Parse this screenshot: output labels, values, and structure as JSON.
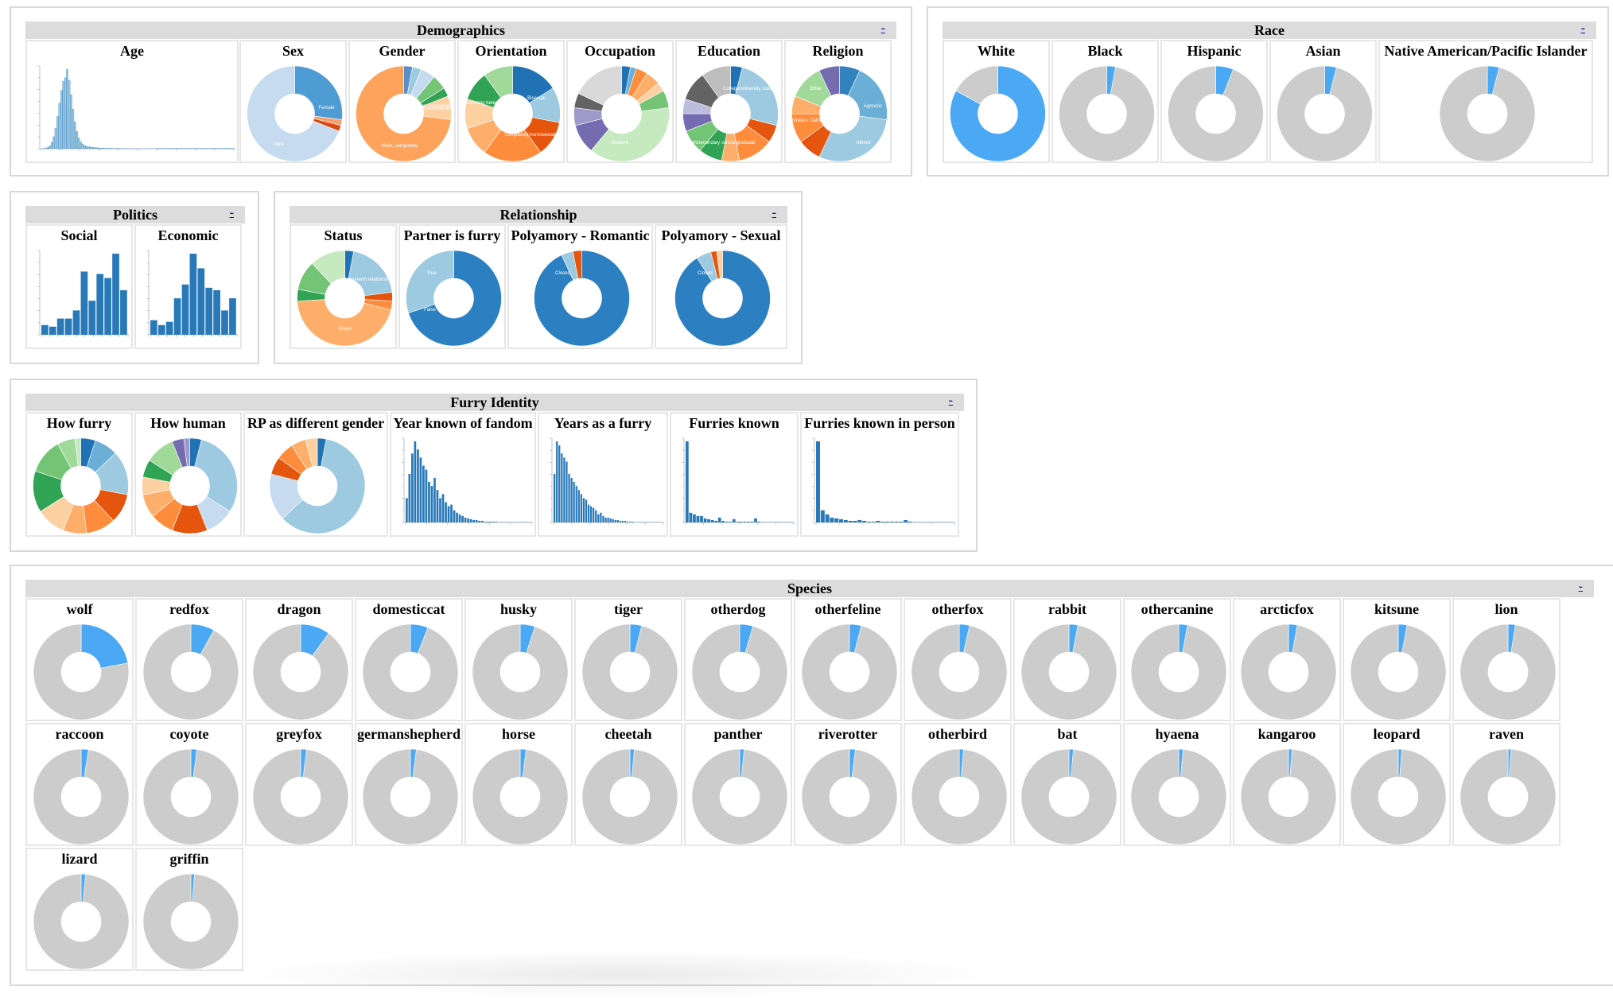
{
  "collapse_symbol": "-",
  "colors": {
    "blue_dark": "#2c80c2",
    "blue_mid": "#6aaed6",
    "blue_light": "#c6dbef",
    "species_highlight": "#4aa8f5",
    "species_rest": "#cccccc",
    "header_bg": "#dcdcdc",
    "bar": "#2979b9"
  },
  "panels": {
    "demographics": {
      "title": "Demographics",
      "charts": [
        {
          "name": "age",
          "title": "Age",
          "kind": "histogram"
        },
        {
          "name": "sex",
          "title": "Sex",
          "kind": "donut",
          "labels": [
            "Female",
            "Male"
          ]
        },
        {
          "name": "gender",
          "title": "Gender",
          "kind": "donut",
          "labels": [
            "Male, predominantly",
            "Female, completely",
            "Male, completely"
          ]
        },
        {
          "name": "orientation",
          "title": "Orientation",
          "kind": "donut",
          "labels": [
            "Bisexual",
            "Completely heterosexual",
            "Completely homosexual"
          ]
        },
        {
          "name": "occupation",
          "title": "Occupation",
          "kind": "donut",
          "labels": [
            "Student"
          ]
        },
        {
          "name": "education",
          "title": "Education",
          "kind": "donut",
          "labels": [
            "College/university student",
            "High/secondary school graduate"
          ]
        },
        {
          "name": "religion",
          "title": "Religion",
          "kind": "donut",
          "labels": [
            "Other",
            "Agnostic",
            "Atheist",
            "Christian, Catholic"
          ]
        }
      ]
    },
    "race": {
      "title": "Race",
      "charts": [
        {
          "name": "white",
          "title": "White",
          "fraction": 0.83
        },
        {
          "name": "black",
          "title": "Black",
          "fraction": 0.03
        },
        {
          "name": "hispanic",
          "title": "Hispanic",
          "fraction": 0.06
        },
        {
          "name": "asian",
          "title": "Asian",
          "fraction": 0.04
        },
        {
          "name": "native-american-pacific-islander",
          "title": "Native American/Pacific Islander",
          "fraction": 0.04
        }
      ]
    },
    "politics": {
      "title": "Politics",
      "charts": [
        {
          "name": "social",
          "title": "Social",
          "kind": "bar"
        },
        {
          "name": "economic",
          "title": "Economic",
          "kind": "bar"
        }
      ]
    },
    "relationship": {
      "title": "Relationship",
      "charts": [
        {
          "name": "status",
          "title": "Status",
          "kind": "donut",
          "labels": [
            "Single",
            "Long-term relationship"
          ]
        },
        {
          "name": "partner-is-furry",
          "title": "Partner is furry",
          "kind": "donut",
          "labels": [
            "True",
            "False"
          ]
        },
        {
          "name": "polyamory-romantic",
          "title": "Polyamory - Romantic",
          "kind": "donut",
          "labels": [
            "Closed"
          ]
        },
        {
          "name": "polyamory-sexual",
          "title": "Polyamory - Sexual",
          "kind": "donut",
          "labels": [
            "Closed"
          ]
        }
      ]
    },
    "furry_identity": {
      "title": "Furry Identity",
      "charts": [
        {
          "name": "how-furry",
          "title": "How furry",
          "kind": "donut"
        },
        {
          "name": "how-human",
          "title": "How human",
          "kind": "donut"
        },
        {
          "name": "rp-as-different-gender",
          "title": "RP as different gender",
          "kind": "donut"
        },
        {
          "name": "year-known-of-fandom",
          "title": "Year known of fandom",
          "kind": "histogram"
        },
        {
          "name": "years-as-a-furry",
          "title": "Years as a furry",
          "kind": "histogram"
        },
        {
          "name": "furries-known",
          "title": "Furries known",
          "kind": "histogram"
        },
        {
          "name": "furries-known-in-person",
          "title": "Furries known in person",
          "kind": "histogram"
        }
      ]
    },
    "species": {
      "title": "Species",
      "items": [
        {
          "name": "wolf",
          "fraction": 0.22
        },
        {
          "name": "redfox",
          "fraction": 0.08
        },
        {
          "name": "dragon",
          "fraction": 0.1
        },
        {
          "name": "domesticcat",
          "fraction": 0.06
        },
        {
          "name": "husky",
          "fraction": 0.05
        },
        {
          "name": "tiger",
          "fraction": 0.04
        },
        {
          "name": "otherdog",
          "fraction": 0.045
        },
        {
          "name": "otherfeline",
          "fraction": 0.04
        },
        {
          "name": "otherfox",
          "fraction": 0.035
        },
        {
          "name": "rabbit",
          "fraction": 0.03
        },
        {
          "name": "othercanine",
          "fraction": 0.03
        },
        {
          "name": "arcticfox",
          "fraction": 0.03
        },
        {
          "name": "kitsune",
          "fraction": 0.03
        },
        {
          "name": "lion",
          "fraction": 0.025
        },
        {
          "name": "raccoon",
          "fraction": 0.025
        },
        {
          "name": "coyote",
          "fraction": 0.02
        },
        {
          "name": "greyfox",
          "fraction": 0.02
        },
        {
          "name": "germanshepherd",
          "fraction": 0.02
        },
        {
          "name": "horse",
          "fraction": 0.02
        },
        {
          "name": "cheetah",
          "fraction": 0.015
        },
        {
          "name": "panther",
          "fraction": 0.015
        },
        {
          "name": "riverotter",
          "fraction": 0.02
        },
        {
          "name": "otherbird",
          "fraction": 0.015
        },
        {
          "name": "bat",
          "fraction": 0.015
        },
        {
          "name": "hyaena",
          "fraction": 0.015
        },
        {
          "name": "kangaroo",
          "fraction": 0.012
        },
        {
          "name": "leopard",
          "fraction": 0.012
        },
        {
          "name": "raven",
          "fraction": 0.01
        },
        {
          "name": "lizard",
          "fraction": 0.015
        },
        {
          "name": "griffin",
          "fraction": 0.012
        }
      ]
    }
  }
}
